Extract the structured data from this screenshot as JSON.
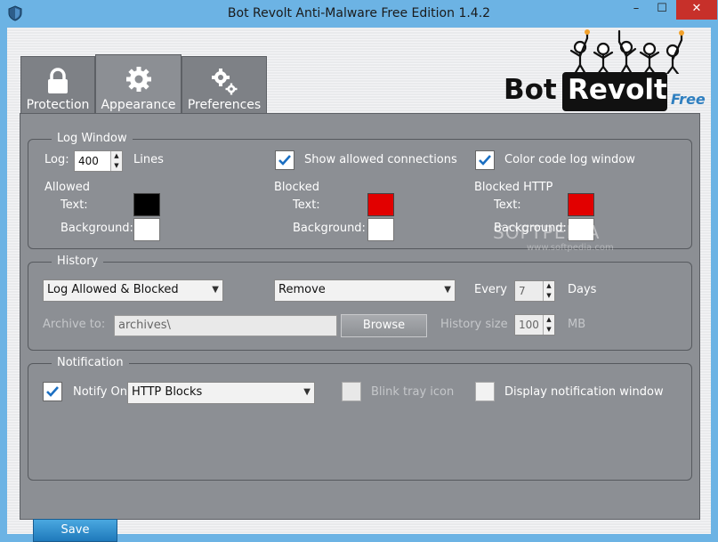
{
  "window": {
    "title": "Bot Revolt Anti-Malware Free Edition 1.4.2",
    "min_glyph": "–",
    "max_glyph": "☐",
    "close_glyph": "✕"
  },
  "logo": {
    "bot": "Bot",
    "revolt": "Revolt",
    "free": "Free"
  },
  "tabs": [
    {
      "label": "Protection",
      "icon": "lock-icon"
    },
    {
      "label": "Appearance",
      "icon": "gear-icon",
      "selected": true
    },
    {
      "label": "Preferences",
      "icon": "gears-icon"
    }
  ],
  "log_window": {
    "title": "Log Window",
    "log_label": "Log:",
    "log_value": "400",
    "lines_label": "Lines",
    "show_allowed_label": "Show allowed connections",
    "show_allowed_checked": true,
    "color_code_label": "Color code log window",
    "color_code_checked": true,
    "allowed_label": "Allowed",
    "blocked_label": "Blocked",
    "blocked_http_label": "Blocked HTTP",
    "text_label": "Text:",
    "background_label": "Background:",
    "colors": {
      "allowed_text": "#000000",
      "allowed_bg": "#ffffff",
      "blocked_text": "#e20000",
      "blocked_bg": "#ffffff",
      "blocked_http_text": "#e20000",
      "blocked_http_bg": "#ffffff"
    }
  },
  "history": {
    "title": "History",
    "mode_value": "Log Allowed & Blocked",
    "action_value": "Remove",
    "every_label": "Every",
    "every_value": "7",
    "days_label": "Days",
    "archive_label": "Archive to:",
    "archive_value": "archives\\",
    "browse_label": "Browse",
    "size_label": "History size",
    "size_value": "100",
    "mb_label": "MB"
  },
  "notification": {
    "title": "Notification",
    "notify_label": "Notify On",
    "notify_checked": true,
    "notify_value": "HTTP Blocks",
    "blink_label": "Blink tray icon",
    "blink_checked": false,
    "display_label": "Display notification window",
    "display_checked": false
  },
  "save_label": "Save",
  "watermark": {
    "main": "SOFTPEDIA",
    "sub": "www.softpedia.com"
  }
}
